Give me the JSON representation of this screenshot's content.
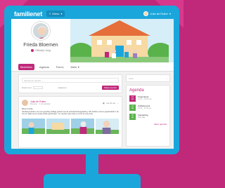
{
  "app": {
    "logo": "familienet",
    "menu_label": "Menu"
  },
  "user": {
    "name": "Julia de Ruiter"
  },
  "profile": {
    "name": "Frieda Bloemen",
    "role": "Cliënt(e) Jong"
  },
  "tabs": [
    {
      "label": "Berichten"
    },
    {
      "label": "Agenda"
    },
    {
      "label": "Foto's"
    },
    {
      "label": "Meer"
    }
  ],
  "composer": {
    "placeholder": "Schrijf een bericht...",
    "share_label": "Delen met",
    "visibility": "Iedereen",
    "submit": "Plaats bericht"
  },
  "post": {
    "author": "Julia de Ruiter",
    "meta": "Bewoner · 2 min geleden",
    "date": "ma 23 okt",
    "greeting": "Beste Frieda,",
    "body": "Vandaag hebben we een gezellig middag gehad met de activiteitenbegeleiding. We hebben samen gewandeld in de tuin en daarna een kopje koffie gedronken. Je moeder was erbij en vond het erg leuk."
  },
  "sidebar": {
    "search_placeholder": "Zoek",
    "agenda_title": "Agenda",
    "events": [
      {
        "day": "19",
        "month": "okt",
        "title": "Kraamfeest",
        "time": "14:00 – 15:00 uur"
      },
      {
        "day": "23",
        "month": "okt",
        "title": "Koffiebezoek",
        "time": "10:00 – 11:00 uur"
      },
      {
        "day": "28",
        "month": "okt",
        "title": "Verjaardag",
        "time": "Hele dag"
      }
    ],
    "more_label": "Meer agenda"
  },
  "colors": {
    "accent": "#c0287a",
    "brand": "#1ba6db",
    "background": "#f1f1f1"
  }
}
